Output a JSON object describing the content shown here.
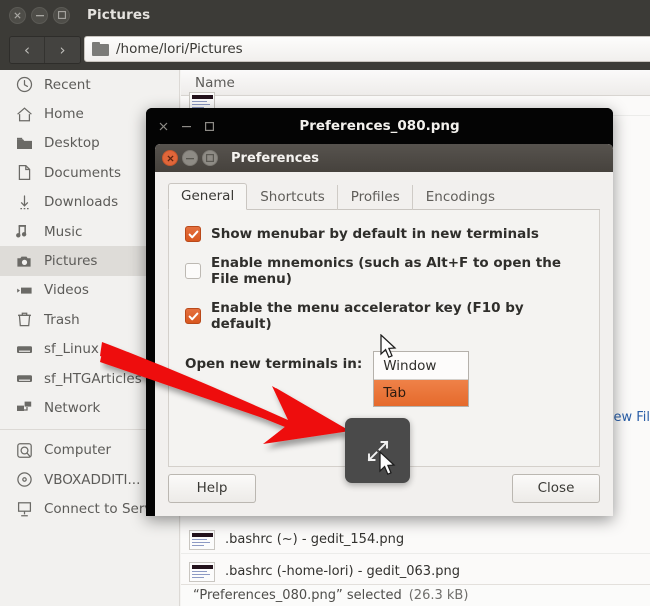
{
  "window": {
    "title": "Pictures",
    "controls": [
      {
        "name": "close",
        "glyph": "×"
      },
      {
        "name": "minimize",
        "glyph": "–"
      },
      {
        "name": "maximize",
        "glyph": "□"
      }
    ],
    "toolbar": {
      "back_label": "‹",
      "forward_label": "›",
      "path": "/home/lori/Pictures",
      "folder_icon": "folder-icon"
    }
  },
  "sidebar": {
    "groups": [
      {
        "items": [
          {
            "label": "Recent",
            "icon": "clock-icon",
            "selected": false
          },
          {
            "label": "Home",
            "icon": "home-icon",
            "selected": false
          },
          {
            "label": "Desktop",
            "icon": "folder-icon",
            "selected": false
          },
          {
            "label": "Documents",
            "icon": "document-icon",
            "selected": false
          },
          {
            "label": "Downloads",
            "icon": "download-arrow-icon",
            "selected": false
          },
          {
            "label": "Music",
            "icon": "music-note-icon",
            "selected": false
          },
          {
            "label": "Pictures",
            "icon": "camera-icon",
            "selected": true
          },
          {
            "label": "Videos",
            "icon": "video-camera-icon",
            "selected": false
          },
          {
            "label": "Trash",
            "icon": "trash-icon",
            "selected": false
          },
          {
            "label": "sf_Linux",
            "icon": "drive-icon",
            "selected": false
          },
          {
            "label": "sf_HTGArticles",
            "icon": "drive-icon",
            "selected": false
          },
          {
            "label": "Network",
            "icon": "network-icon",
            "selected": false
          }
        ]
      },
      {
        "items": [
          {
            "label": "Computer",
            "icon": "hard-disk-icon",
            "selected": false
          },
          {
            "label": "VBOXADDITI...",
            "icon": "optical-disc-icon",
            "selected": false
          },
          {
            "label": "Connect to Server",
            "icon": "server-connect-icon",
            "selected": false
          }
        ]
      }
    ]
  },
  "file_list": {
    "column_header": "Name",
    "rows": [
      {
        "name": "",
        "thumb": "image-thumbnail",
        "partial": true
      },
      {
        "name": ".bashrc (~) - gedit_154.png",
        "thumb": "image-thumbnail",
        "partial": false
      },
      {
        "name": ".bashrc (-home-lori) - gedit_063.png",
        "thumb": "image-thumbnail",
        "partial": false
      }
    ],
    "floating_text_fragment": "ew Fil",
    "status": {
      "selection": "“Preferences_080.png” selected",
      "size": "(26.3 kB)"
    }
  },
  "screenshot_window": {
    "title": "Preferences_080.png",
    "controls": [
      {
        "name": "close",
        "glyph": "×"
      },
      {
        "name": "minimize",
        "glyph": "–"
      },
      {
        "name": "maximize",
        "glyph": "□"
      }
    ]
  },
  "preferences_dialog": {
    "title": "Preferences",
    "controls": [
      {
        "name": "close",
        "glyph": "×",
        "color": "#e0663a"
      },
      {
        "name": "minimize",
        "glyph": "–",
        "color": "#8e8b85"
      },
      {
        "name": "maximize",
        "glyph": "□",
        "color": "#8e8b85"
      }
    ],
    "tabs": [
      {
        "label": "General",
        "active": true
      },
      {
        "label": "Shortcuts",
        "active": false
      },
      {
        "label": "Profiles",
        "active": false
      },
      {
        "label": "Encodings",
        "active": false
      }
    ],
    "checkboxes": [
      {
        "label": "Show menubar by default in new terminals",
        "checked": true
      },
      {
        "label": "Enable mnemonics (such as Alt+F to open the File menu)",
        "checked": false
      },
      {
        "label": "Enable the menu accelerator key (F10 by default)",
        "checked": true
      }
    ],
    "combo": {
      "label": "Open new terminals in:",
      "selected_value": "Window",
      "options": [
        {
          "label": "Window",
          "highlighted": false
        },
        {
          "label": "Tab",
          "highlighted": true
        }
      ]
    },
    "buttons": [
      {
        "label": "Help",
        "name": "help-button"
      },
      {
        "label": "Close",
        "name": "close-button"
      }
    ]
  },
  "overlay": {
    "fullscreen_button": {
      "icon": "expand-arrows-icon",
      "color": "#4a4a4a"
    }
  },
  "annotation": {
    "arrow_color": "#ee1111"
  },
  "colors": {
    "accent_orange": "#e0663a",
    "titlebar_dark": "#3c3b37",
    "annotation_red": "#ee1111",
    "sidebar_bg": "#f2f1ef",
    "dialog_bg": "#f2f0ee"
  }
}
